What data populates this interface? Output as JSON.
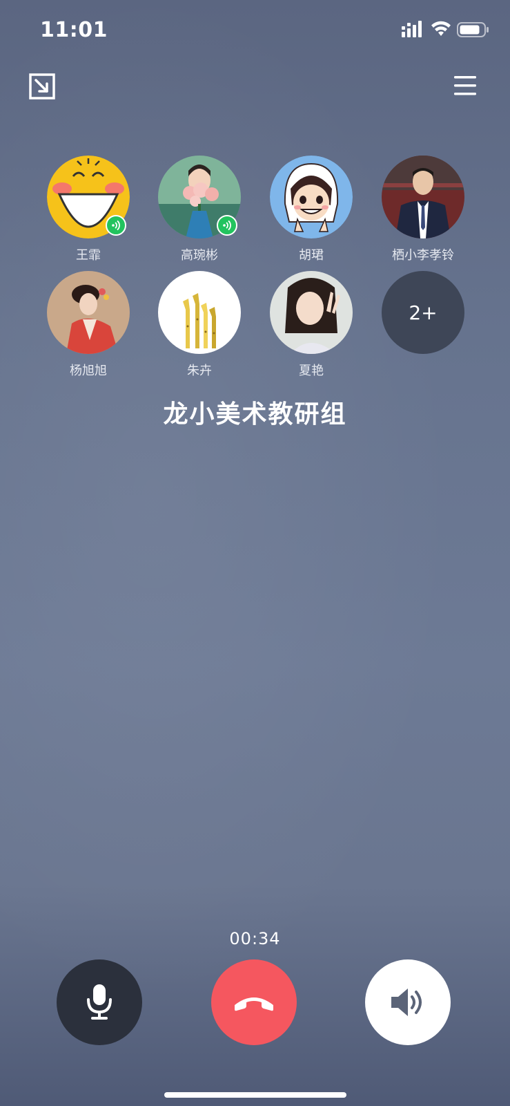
{
  "status_bar": {
    "time": "11:01",
    "icons": [
      "signal-icon",
      "wifi-icon",
      "battery-icon"
    ]
  },
  "header": {
    "minimize_icon": "minimize-icon",
    "menu_icon": "menu-icon"
  },
  "participants": [
    {
      "name": "王霏",
      "speaking": true
    },
    {
      "name": "高琬彬",
      "speaking": true
    },
    {
      "name": "胡珺",
      "speaking": false
    },
    {
      "name": "栖小李孝铃",
      "speaking": false
    },
    {
      "name": "杨旭旭",
      "speaking": false
    },
    {
      "name": "朱卉",
      "speaking": false
    },
    {
      "name": "夏艳",
      "speaking": false
    }
  ],
  "more_count": "2+",
  "group_name": "龙小美术教研组",
  "call": {
    "duration": "00:34",
    "mic_icon": "microphone-icon",
    "hangup_icon": "hang-up-icon",
    "speaker_icon": "speaker-icon"
  },
  "colors": {
    "hangup": "#f5575f",
    "speaking": "#22c35e",
    "mic_bg": "#2b303c"
  }
}
